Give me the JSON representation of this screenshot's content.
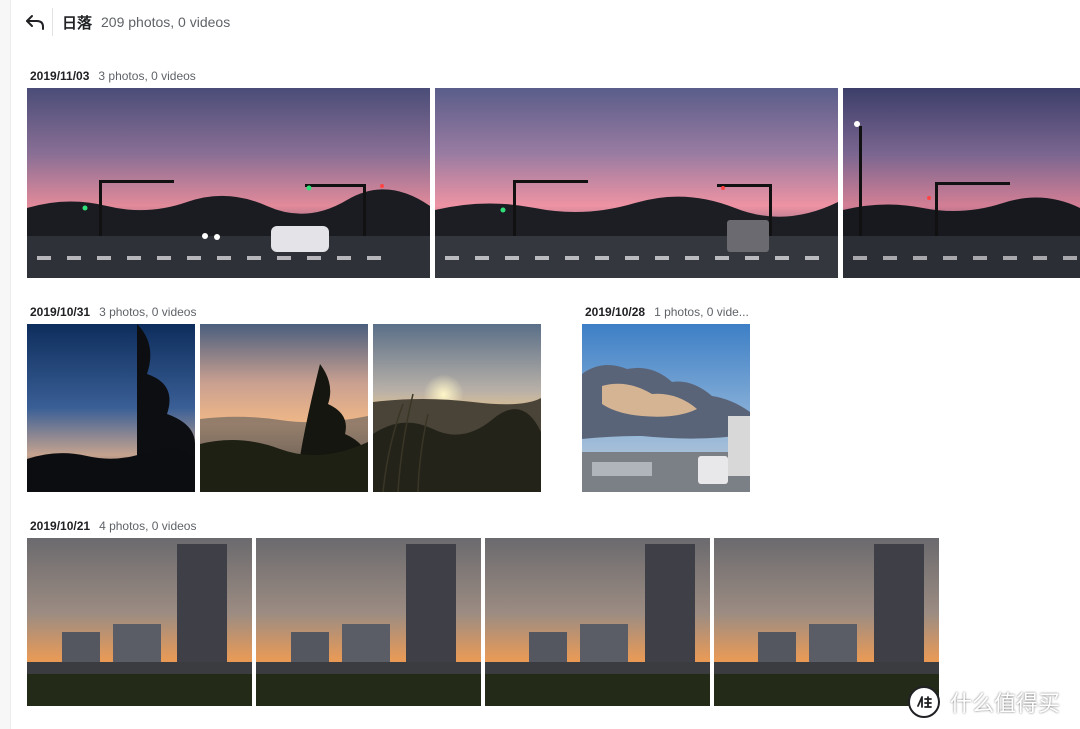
{
  "header": {
    "title": "日落",
    "count": "209 photos, 0 videos"
  },
  "groups": [
    {
      "date": "2019/11/03",
      "count": "3 photos, 0 videos"
    },
    {
      "date": "2019/10/31",
      "count": "3 photos, 0 videos"
    },
    {
      "date": "2019/10/28",
      "count": "1 photos, 0 vide..."
    },
    {
      "date": "2019/10/21",
      "count": "4 photos, 0 videos"
    }
  ],
  "watermark": {
    "text": "什么值得买"
  },
  "colors": {
    "accent": "#202124",
    "muted": "#5f6368"
  }
}
